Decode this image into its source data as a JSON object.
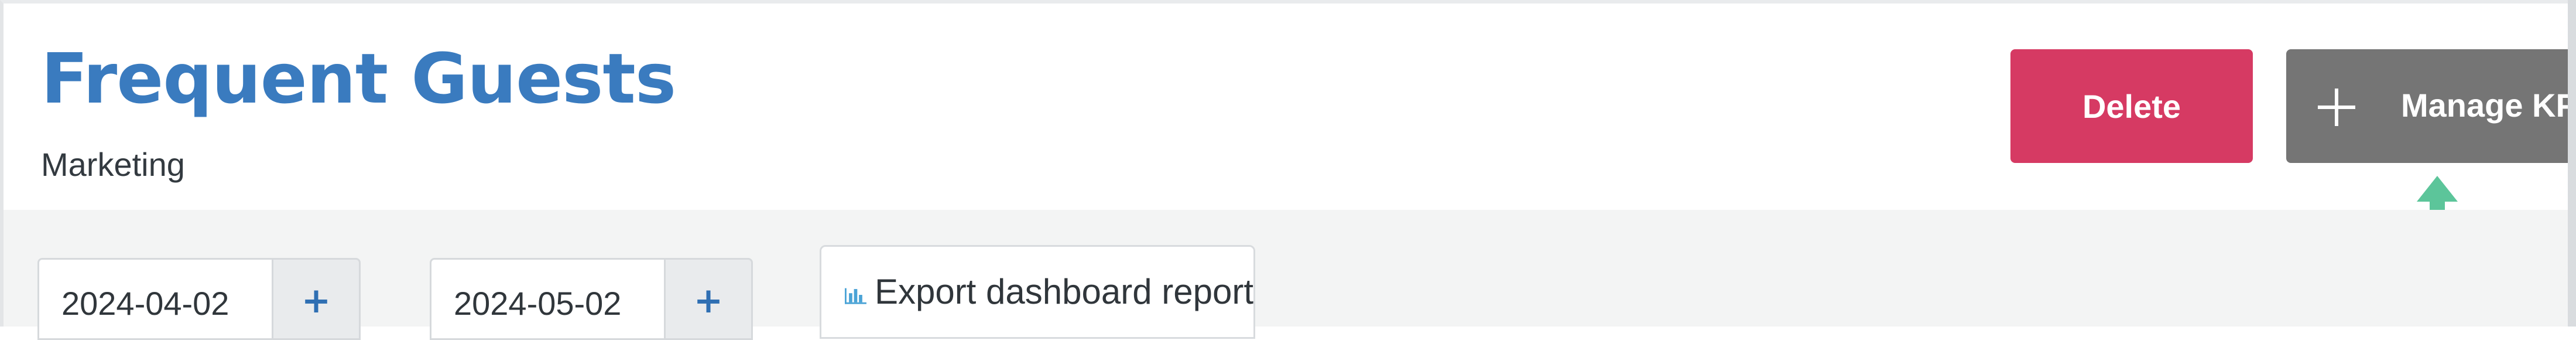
{
  "header": {
    "title": "Frequent Guests",
    "subtitle": "Marketing"
  },
  "actions": {
    "delete_label": "Delete",
    "manage_label": "Manage KPIs"
  },
  "filters": {
    "start_date": "2024-04-02",
    "end_date": "2024-05-02",
    "add_symbol": "+"
  },
  "export": {
    "label": "Export dashboard report"
  },
  "colors": {
    "title": "#3a7bbf",
    "delete": "#d63a63",
    "manage": "#757575",
    "cursor": "#5cc59a",
    "chart_icon": "#4aa3d6"
  },
  "icons": {
    "plus": "plus-icon",
    "chart": "bar-chart-icon",
    "cursor": "arrow-up-icon"
  }
}
